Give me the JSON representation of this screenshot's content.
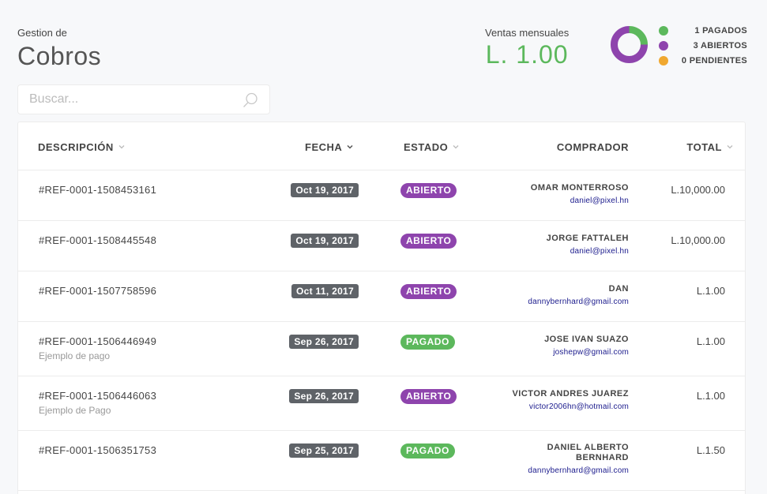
{
  "header": {
    "subtitle": "Gestion de",
    "title": "Cobros"
  },
  "sales": {
    "label": "Ventas mensuales",
    "value": "L. 1.00"
  },
  "summary": {
    "legend": [
      {
        "text": "1 PAGADOS",
        "color": "#5cb85c",
        "count": 1
      },
      {
        "text": "3 ABIERTOS",
        "color": "#8e44ad",
        "count": 3
      },
      {
        "text": "0 PENDIENTES",
        "color": "#f0a830",
        "count": 0
      }
    ]
  },
  "search": {
    "placeholder": "Buscar..."
  },
  "table": {
    "columns": {
      "description": "DESCRIPCIÓN",
      "date": "FECHA",
      "status": "ESTADO",
      "buyer": "COMPRADOR",
      "total": "TOTAL"
    },
    "rows": [
      {
        "ref": "#REF-0001-1508453161",
        "sub": "",
        "date": "Oct 19, 2017",
        "status": "ABIERTO",
        "status_color": "#8e44ad",
        "buyer": "OMAR MONTERROSO",
        "email": "daniel@pixel.hn",
        "total": "L.10,000.00"
      },
      {
        "ref": "#REF-0001-1508445548",
        "sub": "",
        "date": "Oct 19, 2017",
        "status": "ABIERTO",
        "status_color": "#8e44ad",
        "buyer": "JORGE FATTALEH",
        "email": "daniel@pixel.hn",
        "total": "L.10,000.00"
      },
      {
        "ref": "#REF-0001-1507758596",
        "sub": "",
        "date": "Oct 11, 2017",
        "status": "ABIERTO",
        "status_color": "#8e44ad",
        "buyer": "DAN",
        "email": "dannybernhard@gmail.com",
        "total": "L.1.00"
      },
      {
        "ref": "#REF-0001-1506446949",
        "sub": "Ejemplo de pago",
        "date": "Sep 26, 2017",
        "status": "PAGADO",
        "status_color": "#5cb85c",
        "buyer": "JOSE IVAN SUAZO",
        "email": "joshepw@gmail.com",
        "total": "L.1.00"
      },
      {
        "ref": "#REF-0001-1506446063",
        "sub": "Ejemplo de Pago",
        "date": "Sep 26, 2017",
        "status": "ABIERTO",
        "status_color": "#8e44ad",
        "buyer": "VICTOR ANDRES JUAREZ",
        "email": "victor2006hn@hotmail.com",
        "total": "L.1.00"
      },
      {
        "ref": "#REF-0001-1506351753",
        "sub": "",
        "date": "Sep 25, 2017",
        "status": "PAGADO",
        "status_color": "#5cb85c",
        "buyer": "DANIEL ALBERTO BERNHARD",
        "email": "dannybernhard@gmail.com",
        "total": "L.1.50"
      }
    ]
  }
}
